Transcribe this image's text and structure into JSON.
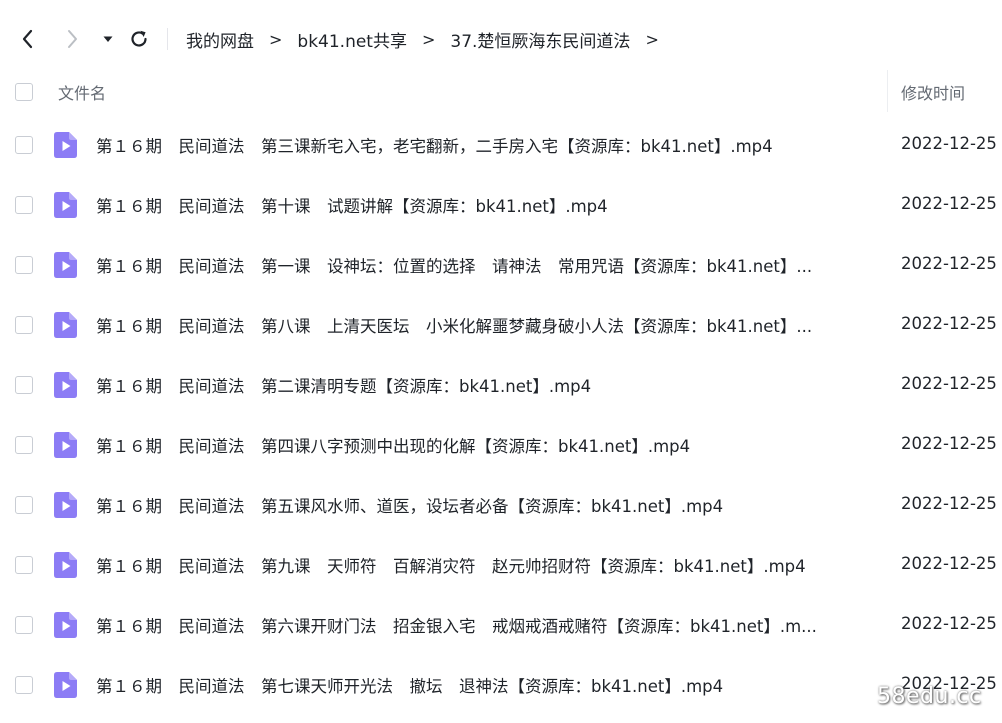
{
  "toolbar": {
    "back_icon": "chevron-left-icon",
    "forward_icon": "chevron-right-icon",
    "dropdown_icon": "caret-down-icon",
    "refresh_icon": "refresh-icon"
  },
  "breadcrumb": {
    "items": [
      "我的网盘",
      "bk41.net共享",
      "37.楚恒厥海东民间道法"
    ],
    "separator": ">"
  },
  "table": {
    "columns": {
      "name": "文件名",
      "modified": "修改时间"
    },
    "rows": [
      {
        "name": "第１６期　民间道法　第三课新宅入宅，老宅翻新，二手房入宅【资源库：bk41.net】.mp4",
        "date": "2022-12-25"
      },
      {
        "name": "第１６期　民间道法　第十课　试题讲解【资源库：bk41.net】.mp4",
        "date": "2022-12-25"
      },
      {
        "name": "第１６期　民间道法　第一课　设神坛：位置的选择　请神法　常用咒语【资源库：bk41.net】...",
        "date": "2022-12-25"
      },
      {
        "name": "第１６期　民间道法　第八课　上清天医坛　小米化解噩梦藏身破小人法【资源库：bk41.net】...",
        "date": "2022-12-25"
      },
      {
        "name": "第１６期　民间道法　第二课清明专题【资源库：bk41.net】.mp4",
        "date": "2022-12-25"
      },
      {
        "name": "第１６期　民间道法　第四课八字预测中出现的化解【资源库：bk41.net】.mp4",
        "date": "2022-12-25"
      },
      {
        "name": "第１６期　民间道法　第五课风水师、道医，设坛者必备【资源库：bk41.net】.mp4",
        "date": "2022-12-25"
      },
      {
        "name": "第１６期　民间道法　第九课　天师符　百解消灾符　赵元帅招财符【资源库：bk41.net】.mp4",
        "date": "2022-12-25"
      },
      {
        "name": "第１６期　民间道法　第六课开财门法　招金银入宅　戒烟戒酒戒赌符【资源库：bk41.net】.m...",
        "date": "2022-12-25"
      },
      {
        "name": "第１６期　民间道法　第七课天师开光法　撤坛　退神法【资源库：bk41.net】.mp4",
        "date": "2022-12-25"
      }
    ]
  },
  "file_icon": "video-file-icon",
  "colors": {
    "video_icon": "#8c7cf5",
    "text": "#1f2329",
    "muted": "#646a73"
  },
  "watermark": "58edu.cc"
}
